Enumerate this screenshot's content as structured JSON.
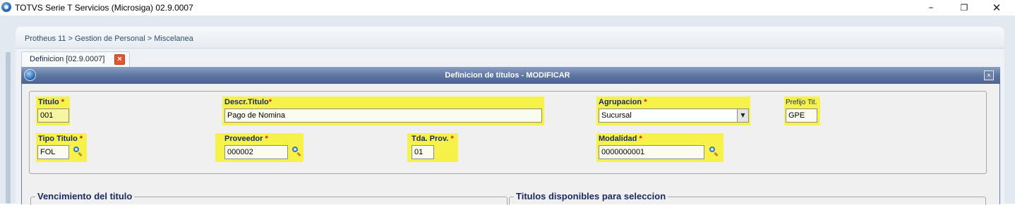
{
  "window": {
    "title": "TOTVS Serie T Servicios (Microsiga) 02.9.0007",
    "minimize": "–",
    "restore": "❐",
    "close": "✕"
  },
  "breadcrumb": "Protheus 11 > Gestion de Personal > Miscelanea",
  "tab": {
    "label": "Definicion [02.9.0007]",
    "close": "×"
  },
  "dialog": {
    "title": "Definicion de titulos - MODIFICAR",
    "close": "×"
  },
  "fields": {
    "titulo": {
      "label": "Titulo",
      "required": "*",
      "value": "001"
    },
    "descr_titulo": {
      "label": "Descr.Titulo",
      "required": "*",
      "value": "Pago de Nomina"
    },
    "agrupacion": {
      "label": "Agrupacion",
      "required": "*",
      "value": "Sucursal",
      "dropdown_icon": "▼"
    },
    "prefijo_tit": {
      "label": "Prefijo Tit.",
      "value": "GPE"
    },
    "tipo_titulo": {
      "label": "Tipo Titulo",
      "required": "*",
      "value": "FOL"
    },
    "proveedor": {
      "label": "Proveedor",
      "required": "*",
      "value": "000002"
    },
    "tda_prov": {
      "label": "Tda. Prov.",
      "required": "*",
      "value": "01"
    },
    "modalidad": {
      "label": "Modalidad",
      "required": "*",
      "value": "0000000001"
    }
  },
  "sections": {
    "vencimiento": "Vencimiento del titulo",
    "titulos_disponibles": "Titulos disponibles para seleccion"
  },
  "colors": {
    "highlight": "#f6f24a",
    "label_text": "#1a2a66",
    "required_star": "#d21c1c",
    "dialog_header": "#5e76a3"
  }
}
